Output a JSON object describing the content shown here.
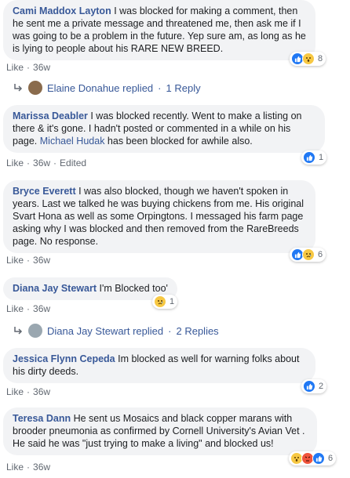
{
  "comments": [
    {
      "author": "Cami Maddox Layton",
      "text": " I was blocked for making a comment, then he sent me a private message and threatened me, then ask me if I was going to be a problem in the future. Yep sure am, as long as he is lying to people about his RARE NEW BREED.",
      "like": "Like",
      "time": "36w",
      "reaction_count": "8",
      "reactions": [
        "like-icon",
        "wow-icon"
      ],
      "reply": {
        "name": "Elaine Donahue replied",
        "count": "1 Reply"
      }
    },
    {
      "author": "Marissa Deabler",
      "text": " I was blocked recently. Went to make a listing on there & it's gone. I hadn't posted or commented in a while on his page. ",
      "mention": "Michael Hudak",
      "text2": " has been blocked for awhile also.",
      "like": "Like",
      "time": "36w",
      "edited": "Edited",
      "reaction_count": "1",
      "reactions": [
        "like-icon"
      ]
    },
    {
      "author": "Bryce Everett",
      "text": " I was also blocked, though we haven't spoken in years. Last we talked he was buying chickens from me. His original Svart Hona as well as some Orpingtons. I messaged his farm page asking why I was blocked and then removed from the RareBreeds page. No response.",
      "like": "Like",
      "time": "36w",
      "reaction_count": "6",
      "reactions": [
        "like-icon",
        "sad-icon"
      ]
    },
    {
      "author": "Diana Jay Stewart",
      "text": " I'm Blocked too'",
      "like": "Like",
      "time": "36w",
      "reaction_count": "1",
      "reactions": [
        "sad-icon"
      ],
      "reply": {
        "name": "Diana Jay Stewart replied",
        "count": "2 Replies"
      }
    },
    {
      "author": "Jessica Flynn Cepeda",
      "text": " Im blocked as well for warning folks about his dirty deeds.",
      "like": "Like",
      "time": "36w",
      "reaction_count": "2",
      "reactions": [
        "like-icon"
      ]
    },
    {
      "author": "Teresa Dann",
      "text": " He sent us Mosaics and black copper marans with brooder pneumonia as confirmed by Cornell University's Avian Vet . He said he was \"just trying to make a living\" and blocked us!",
      "like": "Like",
      "time": "36w",
      "reaction_count": "6",
      "reactions": [
        "wow-icon",
        "angry-icon",
        "like-icon"
      ]
    }
  ],
  "colors": {
    "link": "#385898",
    "bubble": "#f2f3f5",
    "meta": "#606770"
  }
}
